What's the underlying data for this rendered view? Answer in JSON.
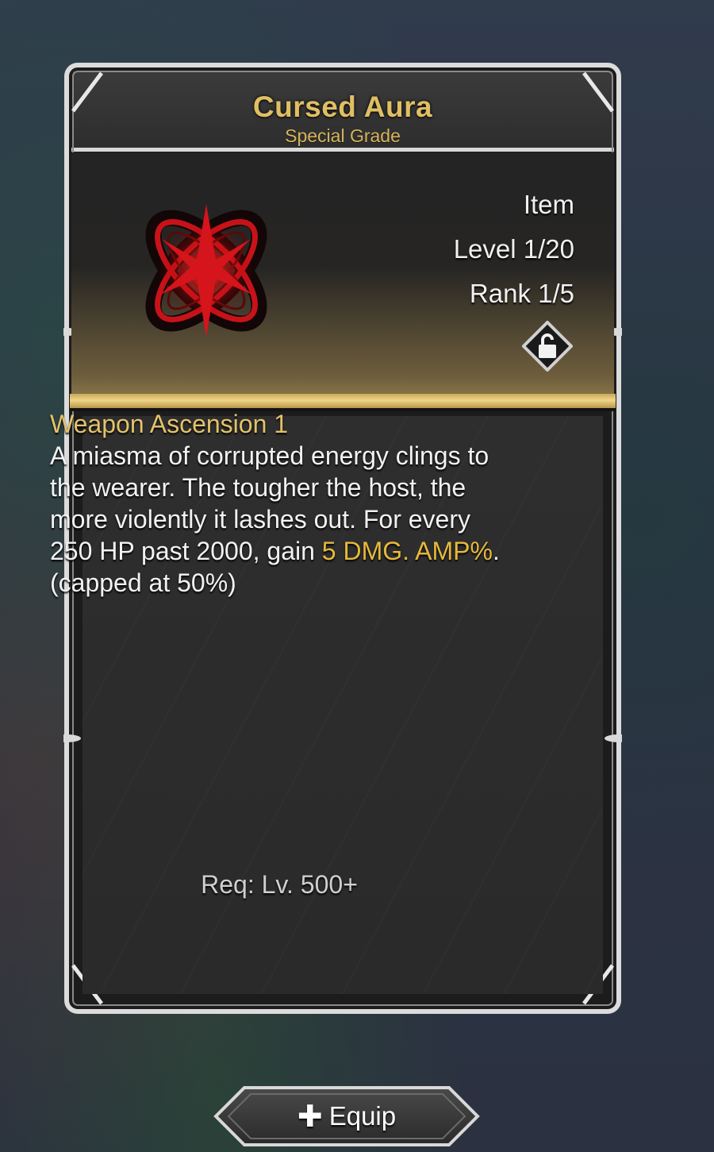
{
  "item": {
    "name": "Cursed Aura",
    "grade": "Special Grade",
    "type": "Item",
    "level": "Level 1/20",
    "rank": "Rank 1/5",
    "icon": "cursed-aura-icon",
    "lock_icon": "unlock-icon",
    "locked": false
  },
  "description": {
    "title": "Weapon Ascension 1",
    "text_before": "A miasma of corrupted energy clings to the wearer. The tougher the host, the more violently it lashes out. For every 250 HP past 2000, gain ",
    "highlight": "5 DMG. AMP%",
    "text_after": ".(capped at 50%)"
  },
  "requirement": "Req: Lv. 500+",
  "equip_button": {
    "icon": "plus-icon",
    "icon_glyph": "✚",
    "label": "Equip"
  },
  "colors": {
    "title_gold": "#e0bf63",
    "highlight": "#e6b93c",
    "icon_red": "#d6141c"
  }
}
